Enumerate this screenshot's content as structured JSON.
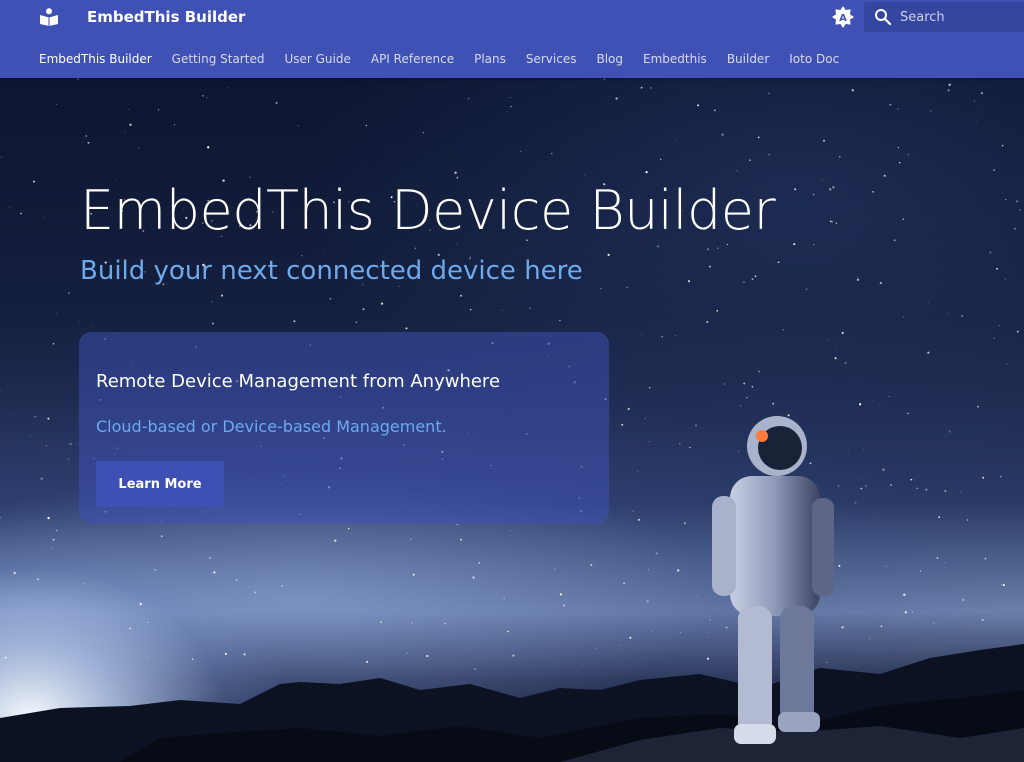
{
  "header": {
    "site_title": "EmbedThis Builder",
    "logo_icon": "book-reader-icon",
    "theme_toggle_icon": "brightness-auto-icon",
    "search": {
      "placeholder": "Search",
      "icon": "search-icon"
    },
    "tabs": [
      {
        "label": "EmbedThis Builder",
        "active": true
      },
      {
        "label": "Getting Started",
        "active": false
      },
      {
        "label": "User Guide",
        "active": false
      },
      {
        "label": "API Reference",
        "active": false
      },
      {
        "label": "Plans",
        "active": false
      },
      {
        "label": "Services",
        "active": false
      },
      {
        "label": "Blog",
        "active": false
      },
      {
        "label": "Embedthis",
        "active": false
      },
      {
        "label": "Builder",
        "active": false
      },
      {
        "label": "Ioto Doc",
        "active": false
      }
    ]
  },
  "hero": {
    "title": "EmbedThis Device Builder",
    "subtitle": "Build your next connected device here",
    "card": {
      "title": "Remote Device Management from Anywhere",
      "text": "Cloud-based or Device-based Management.",
      "button_label": "Learn More"
    }
  },
  "colors": {
    "primary": "#4051b5",
    "accent_text": "#6ea9ec",
    "text_light": "#ffffff"
  }
}
